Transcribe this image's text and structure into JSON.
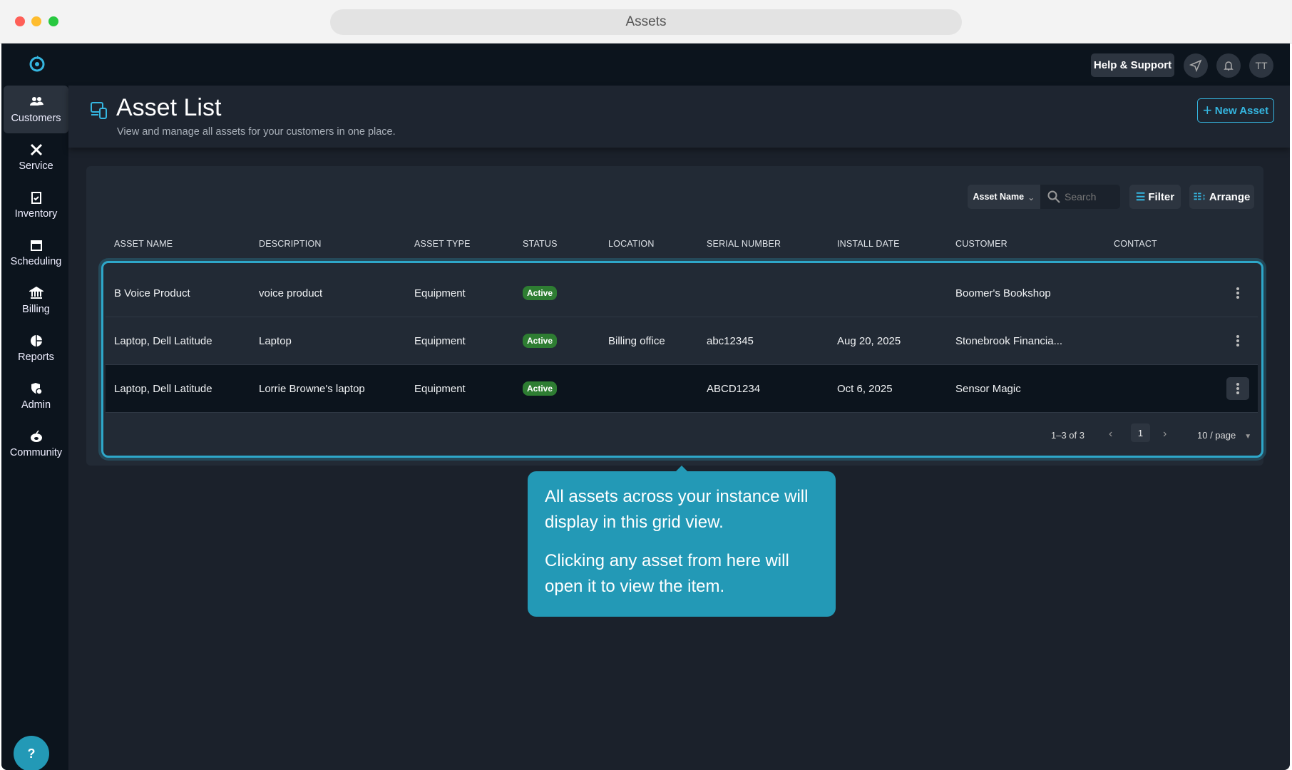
{
  "window": {
    "title": "Assets"
  },
  "topnav": {
    "help": "Help & Support",
    "avatar": "TT"
  },
  "sidebar": {
    "items": [
      {
        "label": "Customers",
        "icon": "users-icon",
        "active": true
      },
      {
        "label": "Service",
        "icon": "tools-icon"
      },
      {
        "label": "Inventory",
        "icon": "clipboard-icon"
      },
      {
        "label": "Scheduling",
        "icon": "calendar-icon"
      },
      {
        "label": "Billing",
        "icon": "bank-icon"
      },
      {
        "label": "Reports",
        "icon": "pie-chart-icon"
      },
      {
        "label": "Admin",
        "icon": "admin-icon"
      },
      {
        "label": "Community",
        "icon": "community-icon"
      }
    ],
    "help": "?"
  },
  "header": {
    "title": "Asset List",
    "subtitle": "View and manage all assets for your customers in one place.",
    "new_button": "New Asset"
  },
  "toolbar": {
    "search_field": "Asset Name",
    "search_placeholder": "Search",
    "filter": "Filter",
    "arrange": "Arrange"
  },
  "table": {
    "columns": [
      "ASSET NAME",
      "DESCRIPTION",
      "ASSET TYPE",
      "STATUS",
      "LOCATION",
      "SERIAL NUMBER",
      "INSTALL DATE",
      "CUSTOMER",
      "CONTACT"
    ],
    "rows": [
      [
        "B Voice Product",
        "voice product",
        "Equipment",
        "Active",
        "",
        "",
        "",
        "Boomer's Bookshop",
        ""
      ],
      [
        "Laptop, Dell Latitude",
        "Laptop",
        "Equipment",
        "Active",
        "Billing office",
        "abc12345",
        "Aug 20, 2025",
        "Stonebrook Financia...",
        ""
      ],
      [
        "Laptop, Dell Latitude",
        "Lorrie Browne's laptop",
        "Equipment",
        "Active",
        "",
        "ABCD1234",
        "Oct 6, 2025",
        "Sensor Magic",
        ""
      ]
    ]
  },
  "pagination": {
    "range": "1–3 of 3",
    "page": "1",
    "per_page": "10 / page"
  },
  "tooltip": {
    "p1": "All assets across your instance will display in this grid view.",
    "p2": "Clicking any asset from here will open it to view the item."
  },
  "colors": {
    "accent": "#2ea7c9",
    "active": "#2e7d32",
    "tooltip": "#2399b6"
  }
}
